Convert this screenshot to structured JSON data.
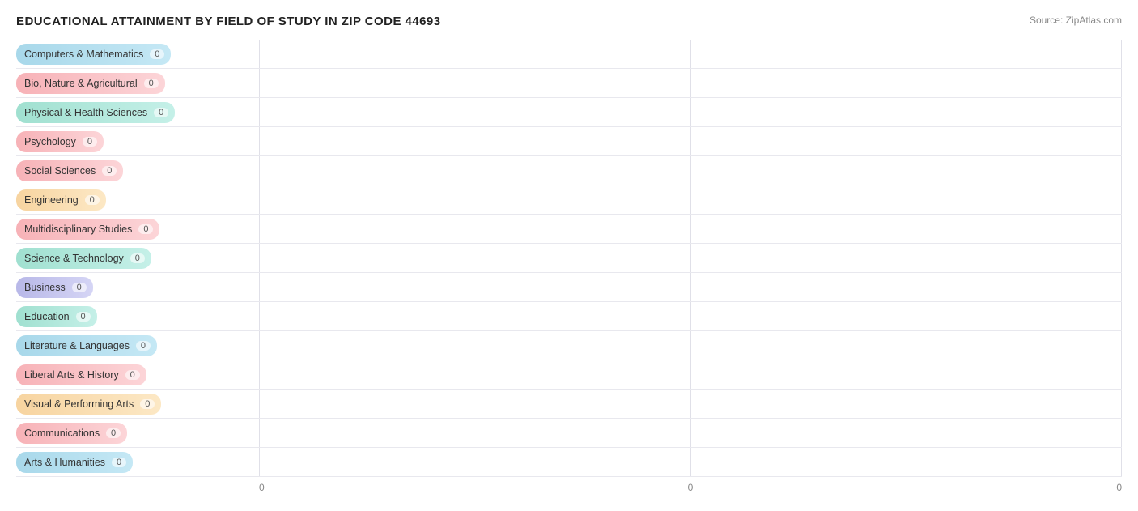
{
  "title": "EDUCATIONAL ATTAINMENT BY FIELD OF STUDY IN ZIP CODE 44693",
  "source": "Source: ZipAtlas.com",
  "bars": [
    {
      "label": "Computers & Mathematics",
      "value": 0,
      "color": "pill-blue"
    },
    {
      "label": "Bio, Nature & Agricultural",
      "value": 0,
      "color": "pill-pink"
    },
    {
      "label": "Physical & Health Sciences",
      "value": 0,
      "color": "pill-teal"
    },
    {
      "label": "Psychology",
      "value": 0,
      "color": "pill-pink"
    },
    {
      "label": "Social Sciences",
      "value": 0,
      "color": "pill-pink"
    },
    {
      "label": "Engineering",
      "value": 0,
      "color": "pill-orange"
    },
    {
      "label": "Multidisciplinary Studies",
      "value": 0,
      "color": "pill-pink"
    },
    {
      "label": "Science & Technology",
      "value": 0,
      "color": "pill-teal"
    },
    {
      "label": "Business",
      "value": 0,
      "color": "pill-lavender"
    },
    {
      "label": "Education",
      "value": 0,
      "color": "pill-teal"
    },
    {
      "label": "Literature & Languages",
      "value": 0,
      "color": "pill-blue"
    },
    {
      "label": "Liberal Arts & History",
      "value": 0,
      "color": "pill-pink"
    },
    {
      "label": "Visual & Performing Arts",
      "value": 0,
      "color": "pill-orange"
    },
    {
      "label": "Communications",
      "value": 0,
      "color": "pill-pink"
    },
    {
      "label": "Arts & Humanities",
      "value": 0,
      "color": "pill-blue"
    }
  ],
  "xAxisLabels": [
    "0",
    "0",
    "0"
  ],
  "value_label": "0"
}
